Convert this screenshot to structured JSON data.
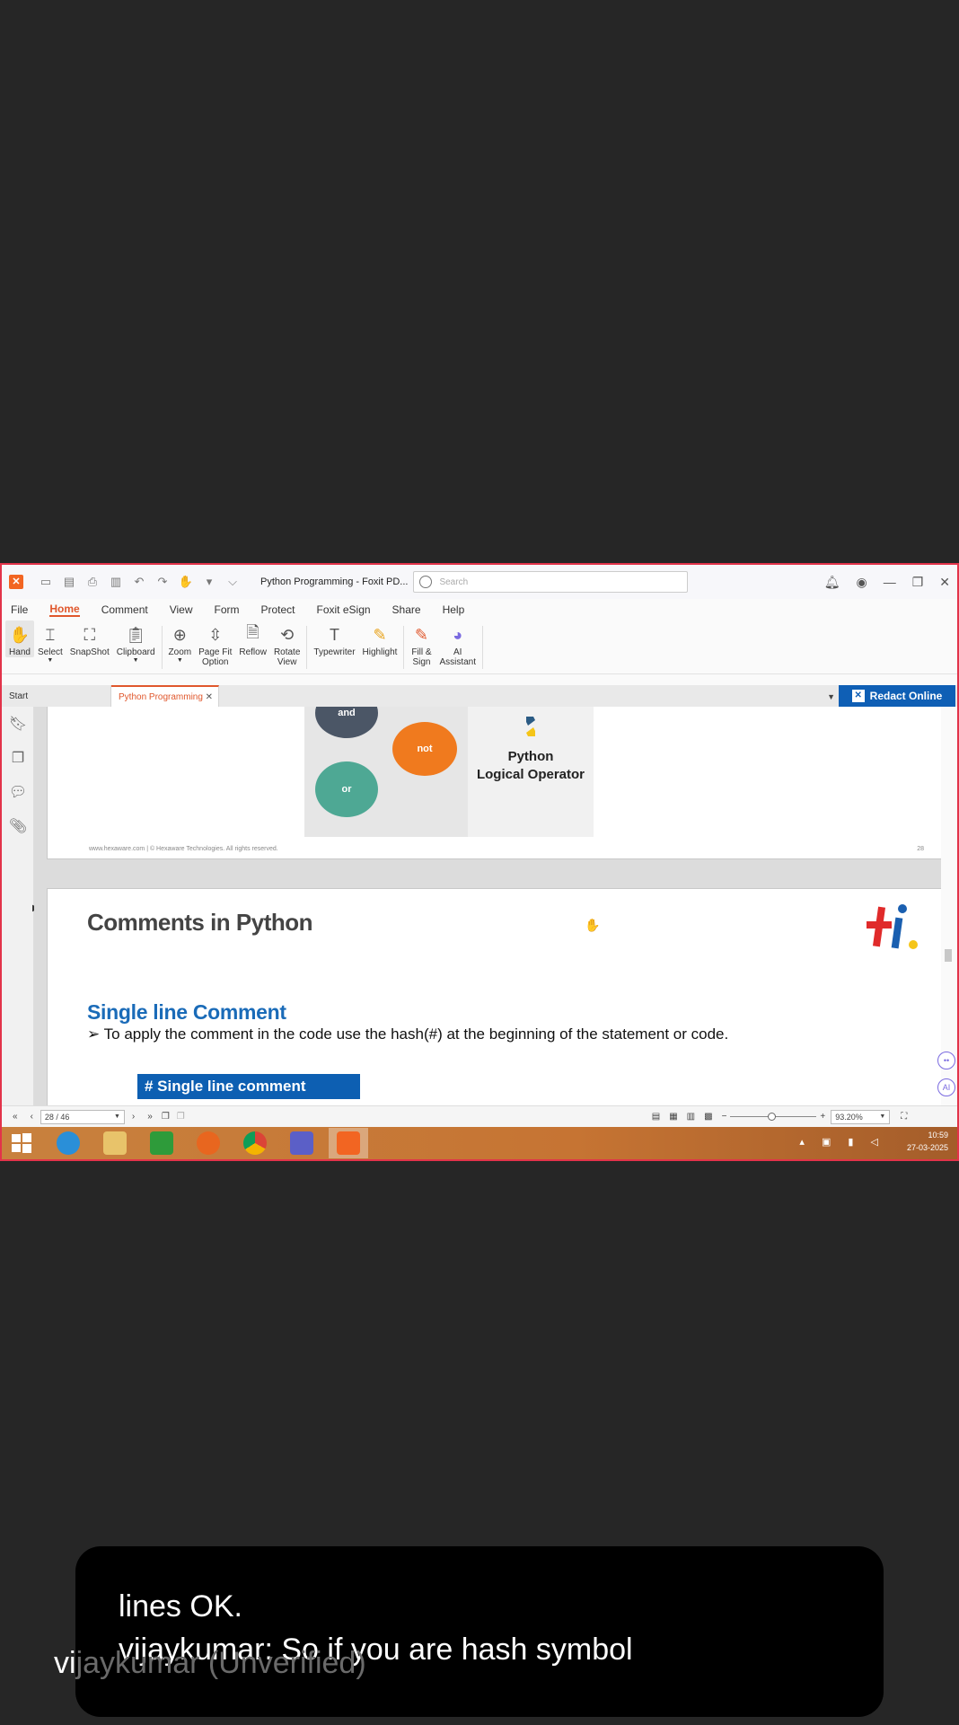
{
  "app": {
    "window_title": "Python Programming - Foxit PD...",
    "search_placeholder": "Search",
    "menu": [
      "File",
      "Home",
      "Comment",
      "View",
      "Form",
      "Protect",
      "Foxit eSign",
      "Share",
      "Help"
    ],
    "active_menu": "Home",
    "ribbon": {
      "hand": "Hand",
      "select": "Select",
      "snapshot": "SnapShot",
      "clipboard": "Clipboard",
      "zoom": "Zoom",
      "page_fit_1": "Page Fit",
      "page_fit_2": "Option",
      "reflow": "Reflow",
      "rotate_1": "Rotate",
      "rotate_2": "View",
      "typewriter": "Typewriter",
      "highlight": "Highlight",
      "fill_sign_1": "Fill &",
      "fill_sign_2": "Sign",
      "ai_1": "AI",
      "ai_2": "Assistant"
    },
    "tabs": {
      "start": "Start",
      "document": "Python Programming"
    },
    "redact_label": "Redact Online"
  },
  "document": {
    "page1": {
      "balls": {
        "and": "and",
        "not": "not",
        "or": "or"
      },
      "logo_line1": "Python",
      "logo_line2": "Logical Operator",
      "footer": "www.hexaware.com | © Hexaware Technologies. All rights reserved.",
      "page_number": "28"
    },
    "page2": {
      "title": "Comments in Python",
      "subtitle": "Single line Comment",
      "bullet": "To apply the comment in the code use the hash(#) at the beginning of the statement or code.",
      "code_box": "# Single line comment"
    }
  },
  "status": {
    "page_indicator": "28 / 46",
    "zoom": "93.20%"
  },
  "taskbar": {
    "time": "10:59",
    "date": "27-03-2025"
  },
  "caption": {
    "line1": "lines OK.",
    "line2": "vijaykumar: So if you are hash symbol",
    "ghost_visible": "vi",
    "ghost_faded": "jaykumar (Unverified)"
  },
  "colors": {
    "accent": "#e0572c",
    "redact": "#0f5fb5",
    "heading_blue": "#1a6bb8",
    "frame": "#e2334a"
  }
}
